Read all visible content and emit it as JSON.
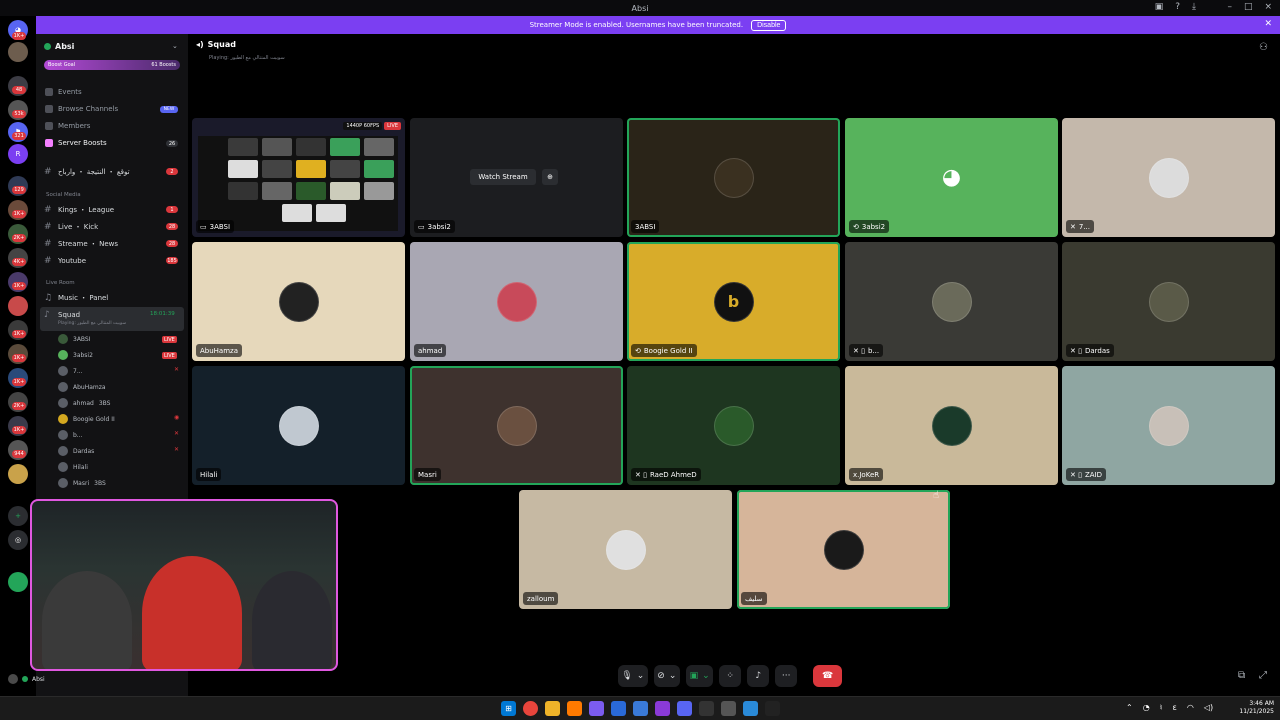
{
  "window": {
    "title": "Absi"
  },
  "banner": {
    "text": "Streamer Mode is enabled. Usernames have been truncated.",
    "disable_label": "Disable"
  },
  "rail": {
    "badges": [
      "1K+",
      "48",
      "53k",
      "321",
      "1K+",
      "129",
      "1K+",
      "2K+",
      "28",
      "4K+",
      "1K+",
      "23",
      "1K+",
      "1K+",
      "1K+",
      "2K+",
      "1K+",
      "1K+",
      "944",
      "2K+",
      "1K+",
      "934",
      "1K+",
      "1K+",
      "2K+",
      "1K+"
    ]
  },
  "server": {
    "name": "Absi",
    "boost_goal": "Boost Goal",
    "boost_count": "61 Boosts"
  },
  "nav": {
    "events": "Events",
    "browse": "Browse Channels",
    "new_badge": "NEW",
    "members": "Members",
    "boosts": "Server Boosts",
    "boosts_count": "26"
  },
  "channels": {
    "results": {
      "name": "توقع ・ النتيجة ・ وارباح",
      "count": "2"
    },
    "social_cat": "Social Media",
    "kings": {
      "name": "Kings ・ League",
      "count": "1"
    },
    "live": {
      "name": "Live ・ Kick",
      "count": "28"
    },
    "streame": {
      "name": "Streame ・ News",
      "count": "28"
    },
    "youtube": {
      "name": "Youtube",
      "count": "185"
    },
    "liveroom_cat": "Live Room",
    "music": {
      "name": "Music ・ Panel"
    },
    "squad": {
      "name": "Squad",
      "time": "18:01:39",
      "playing": "Playing: سوبيت المتتالي مع الطيور"
    }
  },
  "voice_users": [
    {
      "name": "3ABSI",
      "tag": "LIVE"
    },
    {
      "name": "3absi2",
      "tag": "LIVE"
    },
    {
      "name": "7...",
      "tag": ""
    },
    {
      "name": "AbuHamza",
      "tag": ""
    },
    {
      "name": "ahmad",
      "tag": "3BS"
    },
    {
      "name": "Boogie Gold II",
      "tag": ""
    },
    {
      "name": "b...",
      "tag": ""
    },
    {
      "name": "Dardas",
      "tag": ""
    },
    {
      "name": "Hilali",
      "tag": ""
    },
    {
      "name": "Masri",
      "tag": "3BS"
    }
  ],
  "header": {
    "channel": "Squad",
    "playing": "Playing: سوبيت المتتالي مع الطيور"
  },
  "stream": {
    "quality": "1440P 60FPS",
    "live": "LIVE",
    "watch": "Watch Stream"
  },
  "tiles": [
    {
      "name": "3ABSI"
    },
    {
      "name": "3absi2"
    },
    {
      "name": "3ABSI"
    },
    {
      "name": "3absi2"
    },
    {
      "name": "7..."
    },
    {
      "name": "AbuHamza"
    },
    {
      "name": "ahmad"
    },
    {
      "name": "Boogie Gold II"
    },
    {
      "name": "b..."
    },
    {
      "name": "Dardas"
    },
    {
      "name": "Hilali"
    },
    {
      "name": "Masri"
    },
    {
      "name": "RaeD AhmeD"
    },
    {
      "name": "x.JoKeR"
    },
    {
      "name": "ZAID"
    },
    {
      "name": "zalloum"
    },
    {
      "name": "سليف"
    }
  ],
  "user": {
    "name": "Absi"
  },
  "clock": {
    "time": "3:46 AM",
    "date": "11/21/2025"
  },
  "colors": {
    "accent": "#7b3ff2",
    "live": "#da373c",
    "speaking": "#23a559",
    "discord_green": "#57b35c"
  }
}
